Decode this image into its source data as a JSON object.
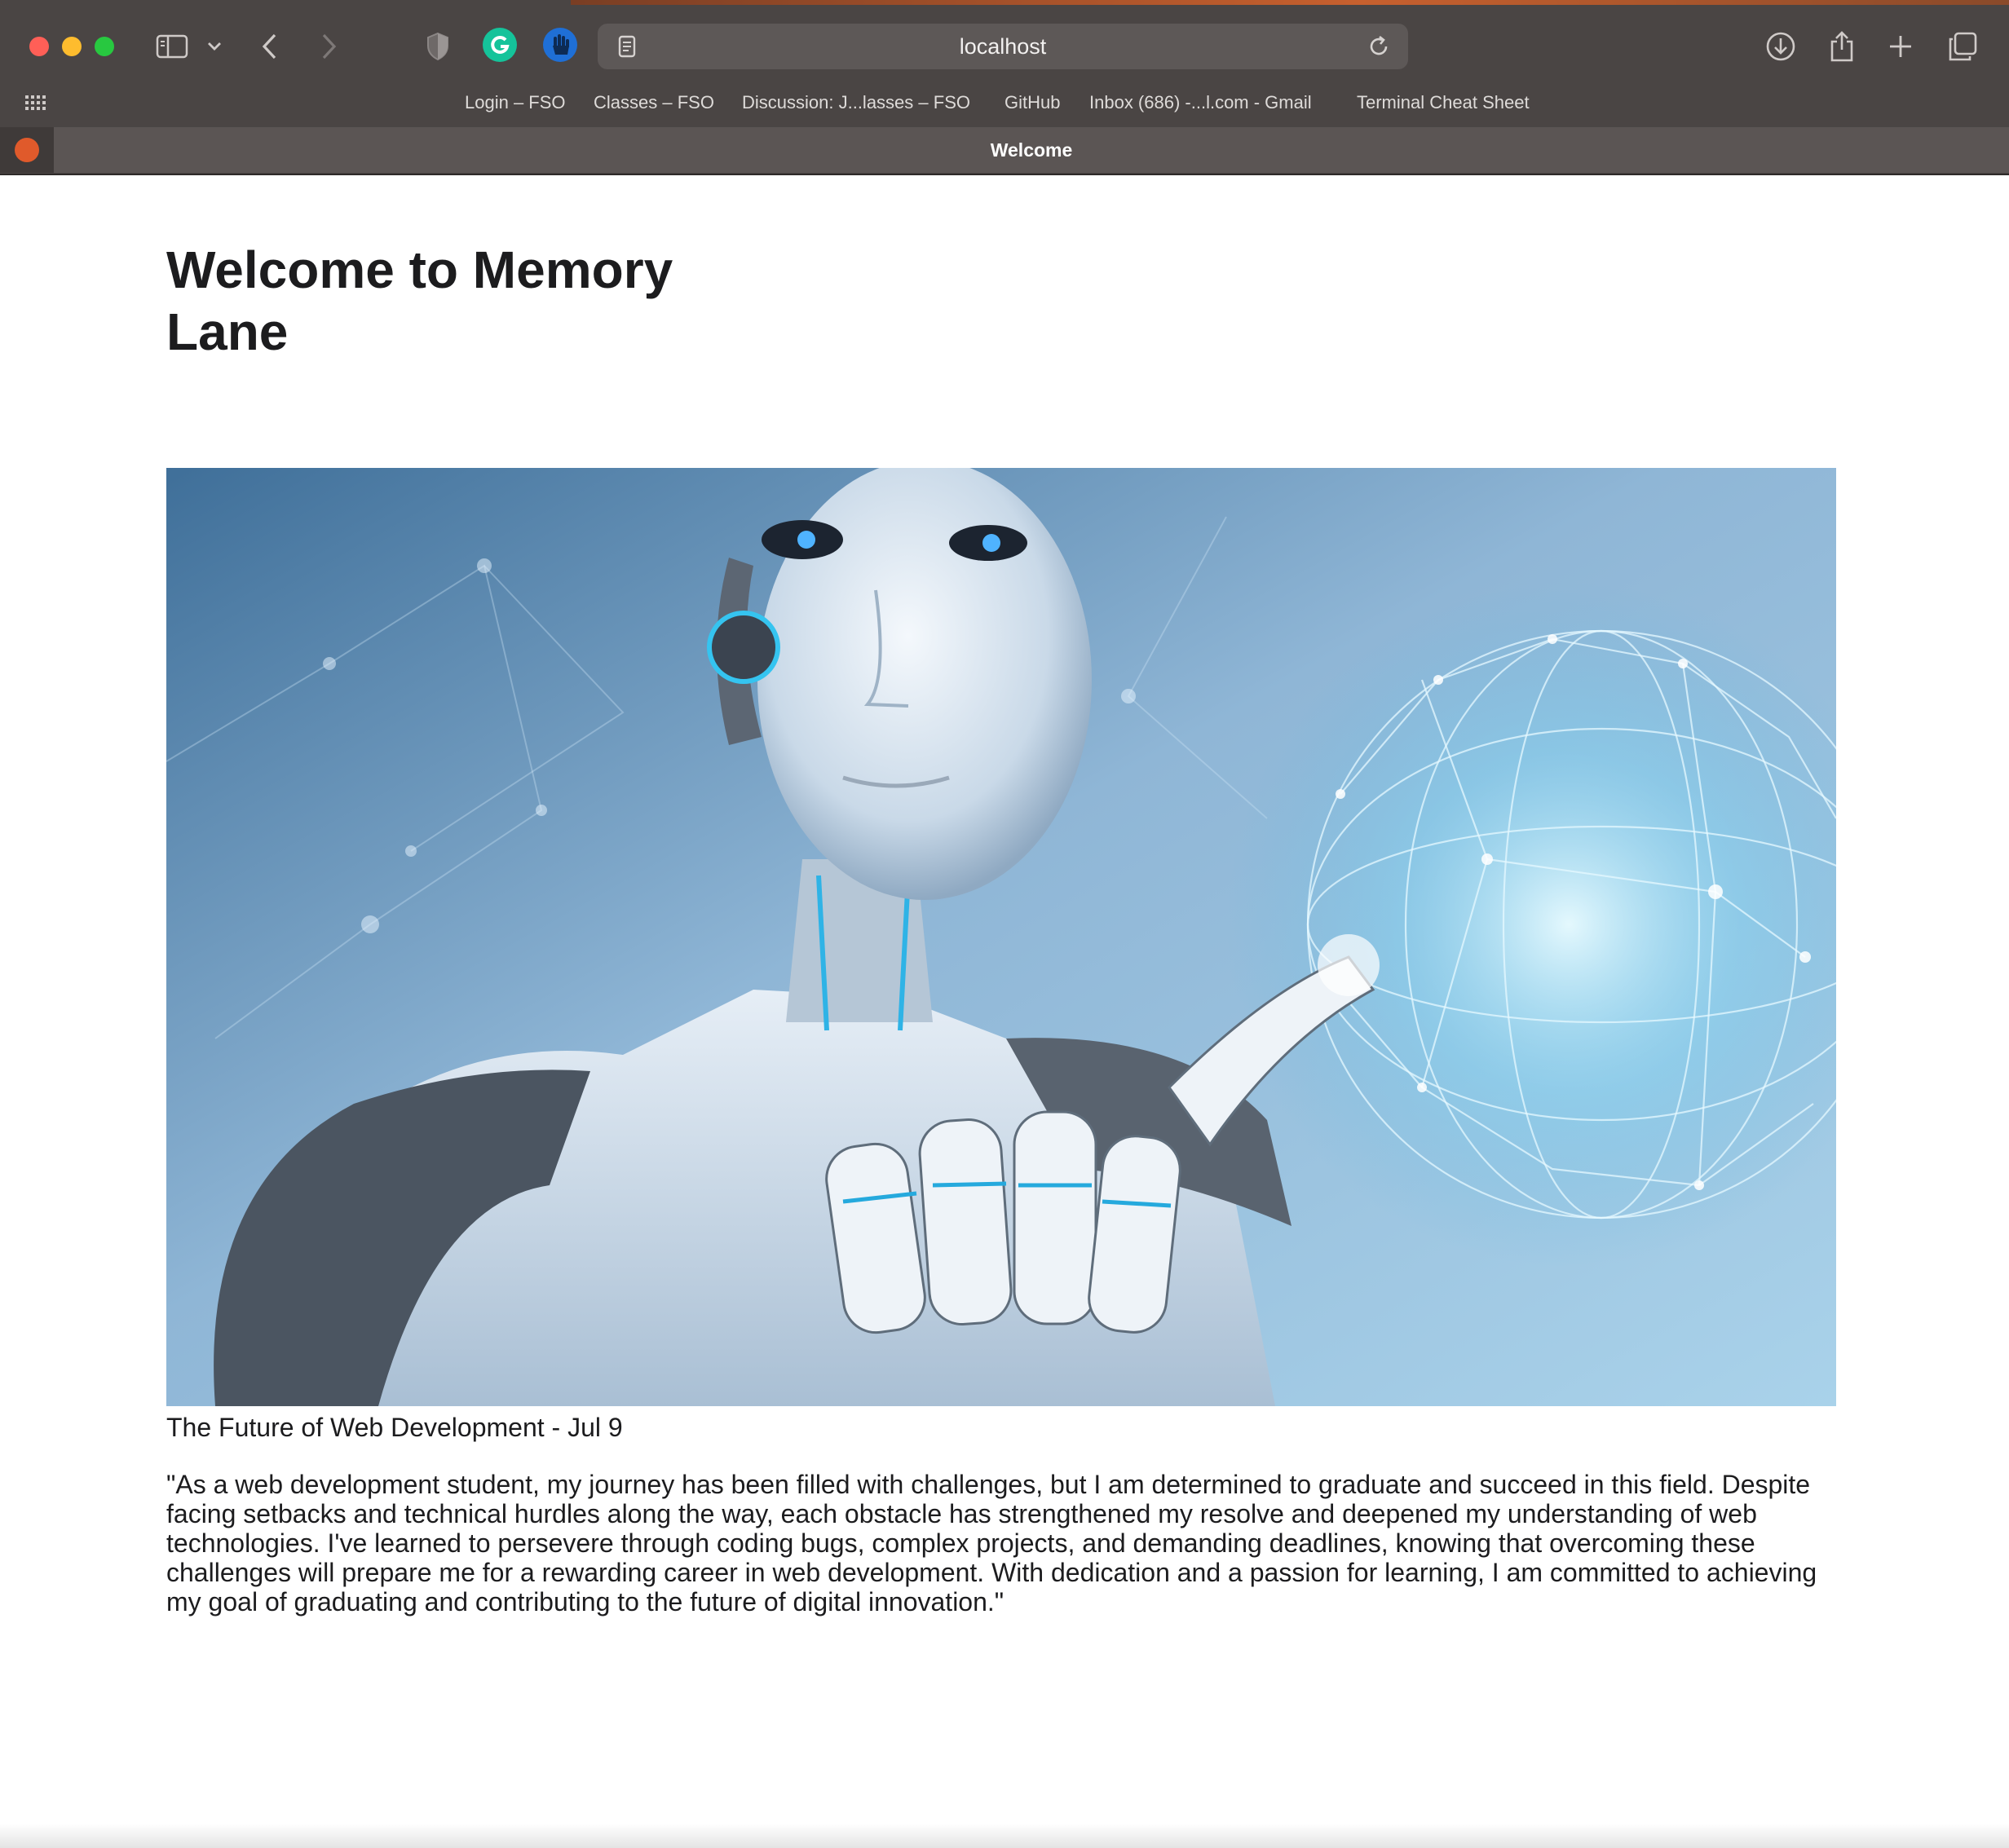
{
  "browser": {
    "url": "localhost",
    "bookmarks": [
      "Login – FSO",
      "Classes – FSO",
      "Discussion: J...lasses – FSO",
      "GitHub",
      "Inbox (686) -...l.com - Gmail",
      "Terminal Cheat Sheet"
    ],
    "active_tab": "Welcome",
    "icons": {
      "sidebar": "sidebar-icon",
      "back": "back-arrow-icon",
      "forward": "forward-arrow-icon",
      "privacy": "shield-icon",
      "grammarly": "grammarly-icon",
      "blocker": "hand-stop-icon",
      "reader": "reader-icon",
      "reload": "reload-icon",
      "downloads": "download-icon",
      "share": "share-icon",
      "new_tab": "plus-icon",
      "tab_overview": "tabs-overview-icon",
      "favorites": "grid-icon"
    },
    "colors": {
      "chrome": "#4a4544",
      "urlbar": "#5d5857",
      "close": "#ff5f57",
      "minimize": "#febc2e",
      "maximize": "#28c840",
      "grammarly": "#15c39a",
      "blocker": "#1f6fd6"
    }
  },
  "page": {
    "title": "Welcome to Memory Lane",
    "hero_image": "white humanoid robot touching a glowing network sphere",
    "caption": "The Future of Web Development - Jul 9",
    "quote": "\"As a web development student, my journey has been filled with challenges, but I am determined to graduate and succeed in this field. Despite facing setbacks and technical hurdles along the way, each obstacle has strengthened my resolve and deepened my understanding of web technologies. I've learned to persevere through coding bugs, complex projects, and demanding deadlines, knowing that overcoming these challenges will prepare me for a rewarding career in web development. With dedication and a passion for learning, I am committed to achieving my goal of graduating and contributing to the future of digital innovation.\""
  }
}
